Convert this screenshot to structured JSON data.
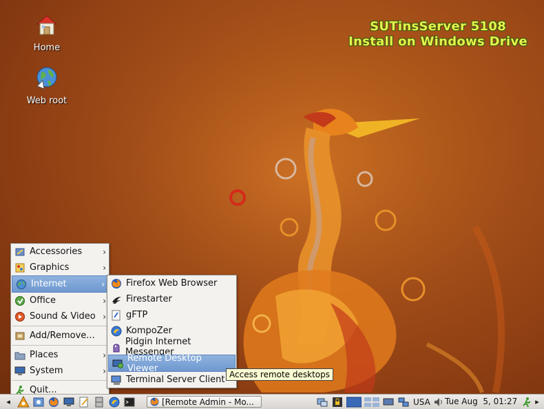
{
  "wallpaper": {
    "title_line1": "SUTinsServer 5108",
    "title_line2": "Install on Windows Drive"
  },
  "desktop_icons": [
    {
      "label": "Home",
      "icon": "home-icon"
    },
    {
      "label": "Web root",
      "icon": "globe-icon"
    }
  ],
  "main_menu": {
    "items": [
      {
        "label": "Accessories",
        "icon": "accessories-icon",
        "submenu": true
      },
      {
        "label": "Graphics",
        "icon": "graphics-icon",
        "submenu": true
      },
      {
        "label": "Internet",
        "icon": "globe-icon",
        "submenu": true,
        "selected": true
      },
      {
        "label": "Office",
        "icon": "office-icon",
        "submenu": true
      },
      {
        "label": "Sound & Video",
        "icon": "sound-video-icon",
        "submenu": true
      },
      {
        "label": "Add/Remove...",
        "icon": "add-remove-icon",
        "submenu": false
      },
      {
        "label": "Places",
        "icon": "folder-icon",
        "submenu": true
      },
      {
        "label": "System",
        "icon": "computer-icon",
        "submenu": true
      },
      {
        "label": "Quit...",
        "icon": "quit-icon",
        "submenu": false
      }
    ]
  },
  "internet_menu": {
    "items": [
      {
        "label": "Firefox Web Browser",
        "icon": "firefox-icon"
      },
      {
        "label": "Firestarter",
        "icon": "firestarter-icon"
      },
      {
        "label": "gFTP",
        "icon": "gftp-icon"
      },
      {
        "label": "KompoZer",
        "icon": "kompozer-icon"
      },
      {
        "label": "Pidgin Internet Messenger",
        "icon": "pidgin-icon"
      },
      {
        "label": "Remote Desktop Viewer",
        "icon": "remote-desktop-icon",
        "selected": true
      },
      {
        "label": "Terminal Server Client",
        "icon": "terminal-server-icon"
      }
    ]
  },
  "tooltip": "Access remote desktops",
  "taskbar": {
    "window_title": "[Remote Admin - Mo...",
    "keyboard_layout": "USA",
    "clock": "Tue Aug  5, 01:27"
  },
  "colors": {
    "wallpaper_orange": "#a9521a",
    "title_green_yellow": "#e6f24a",
    "selection_blue": "#7aa2d6"
  }
}
